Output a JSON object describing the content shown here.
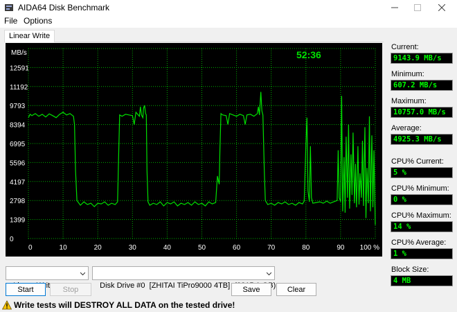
{
  "window": {
    "title": "AIDA64 Disk Benchmark"
  },
  "menu": {
    "file": "File",
    "options": "Options"
  },
  "tabs": [
    "Linear Write"
  ],
  "chart_data": {
    "type": "line",
    "title": "",
    "ylabel": "MB/s",
    "xlabel": "",
    "timer": "52:36",
    "y_ticks": [
      "12591",
      "11192",
      "9793",
      "8394",
      "6995",
      "5596",
      "4197",
      "2798",
      "1399",
      "0"
    ],
    "x_ticks": [
      "0",
      "10",
      "20",
      "30",
      "40",
      "50",
      "60",
      "70",
      "80",
      "90",
      "100 %"
    ],
    "ylim": [
      0,
      13990
    ],
    "xlim": [
      0,
      100
    ],
    "grid": true,
    "series": [
      {
        "color": "#00e000",
        "points": [
          [
            0,
            8900
          ],
          [
            0.5,
            9150
          ],
          [
            1,
            9050
          ],
          [
            2,
            9200
          ],
          [
            3,
            9000
          ],
          [
            4,
            9150
          ],
          [
            5,
            8950
          ],
          [
            6,
            9180
          ],
          [
            7,
            9050
          ],
          [
            8,
            8900
          ],
          [
            9,
            9150
          ],
          [
            10,
            9300
          ],
          [
            11,
            9100
          ],
          [
            12,
            9200
          ],
          [
            13,
            9000
          ],
          [
            13.3,
            8400
          ],
          [
            13.6,
            5000
          ],
          [
            14,
            2800
          ],
          [
            15,
            2450
          ],
          [
            16,
            2700
          ],
          [
            17,
            2500
          ],
          [
            18,
            2600
          ],
          [
            19,
            2350
          ],
          [
            20,
            2600
          ],
          [
            21,
            2550
          ],
          [
            22,
            2700
          ],
          [
            23,
            2450
          ],
          [
            24,
            2600
          ],
          [
            25,
            2500
          ],
          [
            25.7,
            2700
          ],
          [
            26,
            6000
          ],
          [
            26.3,
            9100
          ],
          [
            27,
            9000
          ],
          [
            28,
            9150
          ],
          [
            29,
            9100
          ],
          [
            30,
            9050
          ],
          [
            30.5,
            8400
          ],
          [
            31,
            9300
          ],
          [
            31.5,
            9150
          ],
          [
            32,
            9000
          ],
          [
            32.3,
            9700
          ],
          [
            32.6,
            9100
          ],
          [
            33,
            8900
          ],
          [
            33.2,
            9600
          ],
          [
            33.5,
            9800
          ],
          [
            33.8,
            9200
          ],
          [
            34,
            9100
          ],
          [
            34.2,
            5000
          ],
          [
            34.5,
            2700
          ],
          [
            35,
            2450
          ],
          [
            36,
            2600
          ],
          [
            37,
            2500
          ],
          [
            38,
            2700
          ],
          [
            39,
            2400
          ],
          [
            40,
            2650
          ],
          [
            41,
            2550
          ],
          [
            42,
            2700
          ],
          [
            43,
            2400
          ],
          [
            44,
            2600
          ],
          [
            45,
            2500
          ],
          [
            46,
            2650
          ],
          [
            47,
            2450
          ],
          [
            48,
            2700
          ],
          [
            49,
            2500
          ],
          [
            50,
            2600
          ],
          [
            51,
            2400
          ],
          [
            52,
            2700
          ],
          [
            53,
            2550
          ],
          [
            54,
            2650
          ],
          [
            54.5,
            4600
          ],
          [
            55,
            4000
          ],
          [
            55.2,
            6500
          ],
          [
            55.5,
            9200
          ],
          [
            56,
            9100
          ],
          [
            57,
            9050
          ],
          [
            57.5,
            8400
          ],
          [
            58,
            9200
          ],
          [
            59,
            9100
          ],
          [
            60,
            9000
          ],
          [
            61,
            9150
          ],
          [
            62,
            9050
          ],
          [
            62.5,
            8400
          ],
          [
            63,
            9100
          ],
          [
            64,
            9150
          ],
          [
            65,
            9000
          ],
          [
            66,
            9200
          ],
          [
            66.3,
            9700
          ],
          [
            66.6,
            9100
          ],
          [
            67,
            10800
          ],
          [
            67.3,
            9400
          ],
          [
            67.6,
            9100
          ],
          [
            68,
            5000
          ],
          [
            68.3,
            2800
          ],
          [
            69,
            2500
          ],
          [
            70,
            2600
          ],
          [
            71,
            2450
          ],
          [
            72,
            2650
          ],
          [
            73,
            2550
          ],
          [
            74,
            2700
          ],
          [
            75,
            2500
          ],
          [
            76,
            2600
          ],
          [
            77,
            2450
          ],
          [
            78,
            2650
          ],
          [
            79,
            2550
          ],
          [
            79.5,
            2750
          ],
          [
            80,
            7000
          ],
          [
            80.3,
            8900
          ],
          [
            80.6,
            3500
          ],
          [
            81,
            2700
          ],
          [
            81.3,
            6800
          ],
          [
            81.6,
            3000
          ],
          [
            82,
            2600
          ],
          [
            83,
            2650
          ],
          [
            84,
            2700
          ],
          [
            85,
            2600
          ],
          [
            86,
            2750
          ],
          [
            87,
            2600
          ],
          [
            88,
            2700
          ],
          [
            89,
            2800
          ],
          [
            89.3,
            6500
          ],
          [
            89.6,
            3000
          ],
          [
            90,
            2700
          ],
          [
            90.3,
            10500
          ],
          [
            90.6,
            2000
          ],
          [
            91,
            6000
          ],
          [
            91.3,
            1900
          ],
          [
            91.6,
            7500
          ],
          [
            92,
            3000
          ],
          [
            92.3,
            8400
          ],
          [
            92.6,
            2200
          ],
          [
            93,
            6200
          ],
          [
            93.3,
            3200
          ],
          [
            93.6,
            7800
          ],
          [
            94,
            2600
          ],
          [
            94.3,
            5500
          ],
          [
            94.6,
            2300
          ],
          [
            95,
            6800
          ],
          [
            95.3,
            2500
          ],
          [
            95.6,
            4800
          ],
          [
            96,
            3000
          ],
          [
            96.3,
            7200
          ],
          [
            96.6,
            2400
          ],
          [
            97,
            8200
          ],
          [
            97.3,
            1500
          ],
          [
            97.6,
            5200
          ],
          [
            98,
            2600
          ],
          [
            98.3,
            9000
          ],
          [
            98.6,
            2000
          ],
          [
            99,
            7600
          ],
          [
            99.3,
            2300
          ],
          [
            99.6,
            6500
          ],
          [
            100,
            1000
          ]
        ]
      }
    ]
  },
  "stats": [
    {
      "label": "Current:",
      "value": "9143.9 MB/s"
    },
    {
      "label": "Minimum:",
      "value": "607.2 MB/s"
    },
    {
      "label": "Maximum:",
      "value": "10757.0 MB/s"
    },
    {
      "label": "Average:",
      "value": "4925.3 MB/s"
    },
    {
      "label": "CPU% Current:",
      "value": "5 %"
    },
    {
      "label": "CPU% Minimum:",
      "value": "0 %"
    },
    {
      "label": "CPU% Maximum:",
      "value": "14 %"
    },
    {
      "label": "CPU% Average:",
      "value": "1 %"
    },
    {
      "label": "Block Size:",
      "value": "4 MB"
    }
  ],
  "controls": {
    "test_select": "Linear Write",
    "drive_select": "Disk Drive #0  [ZHITAI TiPro9000 4TB]  (3815.1 GB)",
    "start": "Start",
    "stop": "Stop",
    "save": "Save",
    "clear": "Clear"
  },
  "warning": "Write tests will DESTROY ALL DATA on the tested drive!",
  "colors": {
    "plot": "#00e000",
    "grid": "#00b000",
    "value_text": "#00ff00",
    "accent": "#0078d4"
  }
}
